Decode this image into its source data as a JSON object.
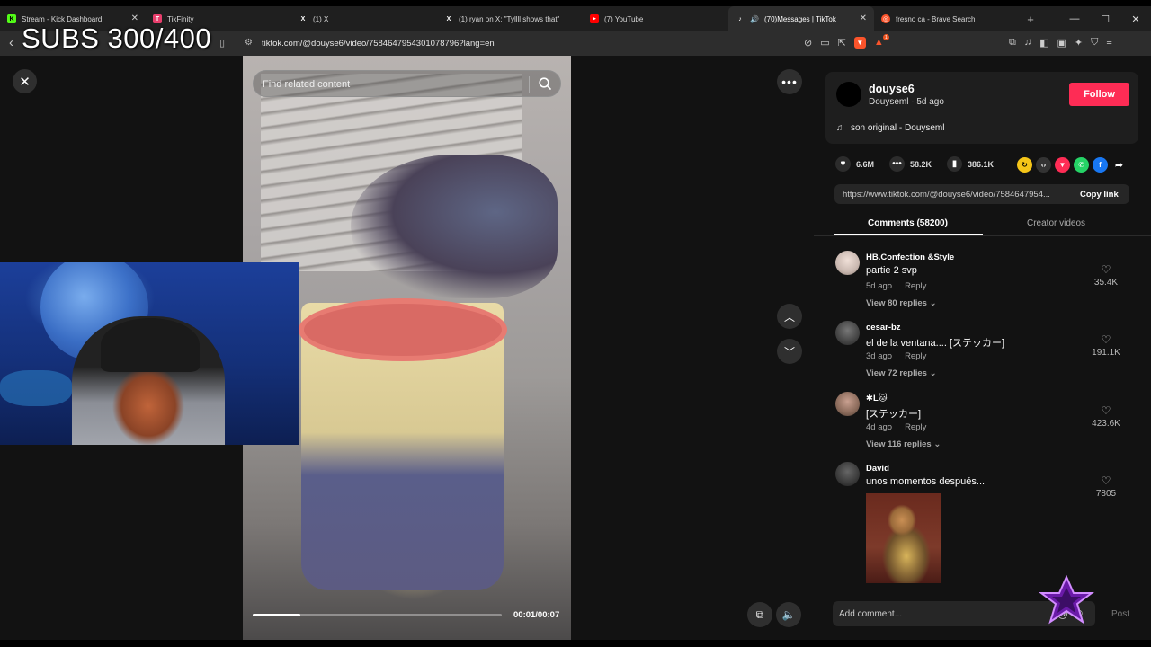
{
  "overlay": {
    "subs_text": "SUBS 300/400"
  },
  "browser": {
    "tabs": [
      {
        "label": "Stream - Kick Dashboard",
        "icon": "kick-icon",
        "color": "#53fc18"
      },
      {
        "label": "TikFinity",
        "icon": "tikfinity-icon",
        "color": "#e83e6c"
      },
      {
        "label": "(1) X",
        "icon": "x-icon",
        "color": "#ffffff"
      },
      {
        "label": "(1) ryan on X: \"Tyllll shows that\"",
        "icon": "x-icon",
        "color": "#ffffff"
      },
      {
        "label": "(7) YouTube",
        "icon": "youtube-icon",
        "color": "#ff0000"
      },
      {
        "label": "(70)Messages | TikTok",
        "icon": "tiktok-icon",
        "color": "#ffffff"
      },
      {
        "label": "fresno ca - Brave Search",
        "icon": "brave-search-icon",
        "color": "#fb542b"
      }
    ],
    "active_tab_index": 5,
    "url": "tiktok.com/@douyse6/video/7584647954301078796?lang=en"
  },
  "video": {
    "search_placeholder": "Find related content",
    "time": "00:01/00:07",
    "progress": 0.19
  },
  "author": {
    "username": "douyse6",
    "subline": "Douyseml · 5d ago",
    "follow_label": "Follow",
    "music": "son original - Douyseml"
  },
  "stats": {
    "likes": "6.6M",
    "comments": "58.2K",
    "saves": "386.1K"
  },
  "share": {
    "link": "https://www.tiktok.com/@douyse6/video/7584647954...",
    "copy_label": "Copy link"
  },
  "panel_tabs": {
    "comments": "Comments (58200)",
    "creator": "Creator videos"
  },
  "comments": [
    {
      "name": "HB.Confection &Style",
      "text": "partie 2 svp",
      "time": "5d ago",
      "reply": "Reply",
      "replies": "View 80 replies ⌄",
      "likes": "35.4K",
      "avatar_color": "#c9b8b0"
    },
    {
      "name": "cesar-bz",
      "text": "el de la ventana.... [ステッカー]",
      "time": "3d ago",
      "reply": "Reply",
      "replies": "View 72 replies ⌄",
      "likes": "191.1K",
      "avatar_color": "#555555"
    },
    {
      "name": "✱L🐱",
      "text": "[ステッカー]",
      "time": "4d ago",
      "reply": "Reply",
      "replies": "View 116 replies ⌄",
      "likes": "423.6K",
      "avatar_color": "#8a6a5a"
    },
    {
      "name": "David",
      "text": "unos momentos después...",
      "time": "",
      "reply": "",
      "replies": "",
      "likes": "7805",
      "avatar_color": "#4a4a4a"
    }
  ],
  "compose": {
    "placeholder": "Add comment...",
    "post_label": "Post"
  }
}
